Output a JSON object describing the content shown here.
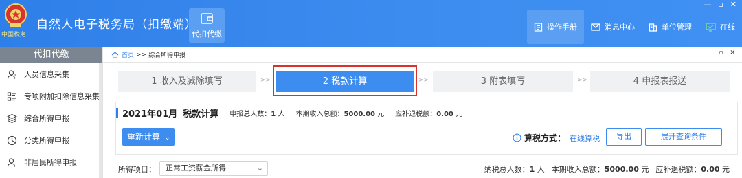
{
  "header": {
    "brand_sub": "中国税务",
    "app_title": "自然人电子税务局（扣缴端）",
    "nav_active_label": "代扣代缴",
    "right_items": [
      {
        "label": "操作手册",
        "icon": "manual-icon"
      },
      {
        "label": "消息中心",
        "icon": "mail-icon"
      },
      {
        "label": "单位管理",
        "icon": "building-icon"
      },
      {
        "label": "在线",
        "icon": "online-icon"
      }
    ],
    "window_controls": [
      "—",
      "▫",
      "✕"
    ]
  },
  "sidebar": {
    "title": "代扣代缴",
    "items": [
      {
        "label": "人员信息采集",
        "icon": "person-icon"
      },
      {
        "label": "专项附加扣除信息采集",
        "icon": "list-icon"
      },
      {
        "label": "综合所得申报",
        "icon": "layers-icon"
      },
      {
        "label": "分类所得申报",
        "icon": "pie-icon"
      },
      {
        "label": "非居民所得申报",
        "icon": "person-alt-icon"
      }
    ]
  },
  "breadcrumb": {
    "home": "首页",
    "separator": ">>",
    "current": "综合所得申报"
  },
  "content_window_controls": [
    "▫",
    "✕"
  ],
  "steps": [
    {
      "label": "1 收入及减除填写",
      "active": false
    },
    {
      "label": "2 税款计算",
      "active": true
    },
    {
      "label": "3 附表填写",
      "active": false
    },
    {
      "label": "4 申报表报送",
      "active": false
    }
  ],
  "step_separator": ">>",
  "panel": {
    "period": "2021年01月",
    "title": "税款计算",
    "declare_count_label": "申报总人数：",
    "declare_count_value": "1",
    "declare_count_unit": "人",
    "income_label": "本期收入总额：",
    "income_value": "5000.00",
    "income_unit": "元",
    "refund_label": "应补退税额：",
    "refund_value": "0.00",
    "refund_unit": "元",
    "recalc_button": "重新计算",
    "calc_method_label": "算税方式：",
    "calc_method_value": "在线算税",
    "export_button": "导出",
    "expand_button": "展开查询条件"
  },
  "filter": {
    "label": "所得项目：",
    "selected": "正常工资薪金所得"
  },
  "summary": {
    "taxpayer_label": "纳税总人数：",
    "taxpayer_value": "1",
    "taxpayer_unit": "人",
    "income_label": "本期收入总额：",
    "income_value": "5000.00",
    "income_unit": "元",
    "refund_label": "应补退税额：",
    "refund_value": "0.00",
    "refund_unit": "元"
  },
  "colors": {
    "header_blue": "#3d8df0",
    "sidebar_head": "#7b8591",
    "highlight_red": "#d9312b",
    "link_blue": "#2f7fe9"
  }
}
